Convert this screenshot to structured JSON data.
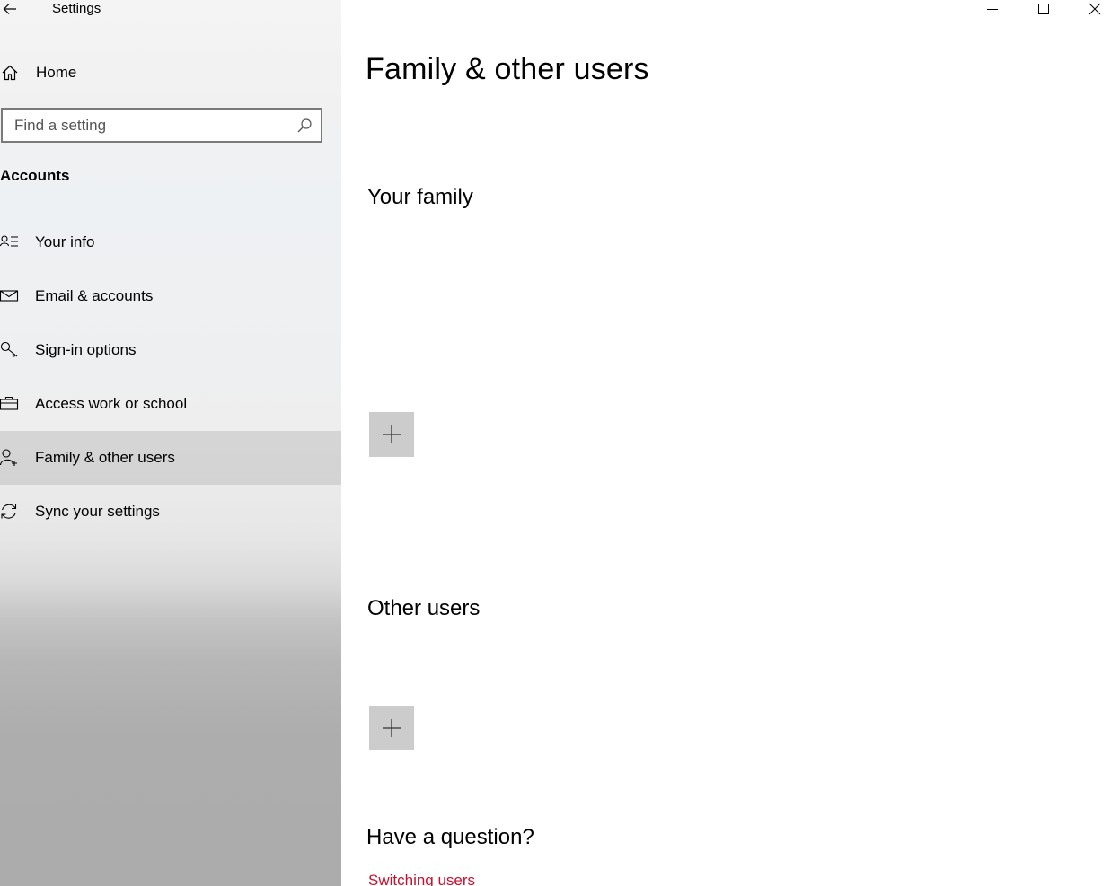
{
  "window": {
    "app_title": "Settings",
    "back_icon": "arrow-left-icon",
    "minimize_icon": "minimize-icon",
    "maximize_icon": "maximize-icon",
    "close_icon": "close-icon"
  },
  "sidebar": {
    "home_label": "Home",
    "home_icon": "home-icon",
    "search": {
      "placeholder": "Find a setting",
      "value": "",
      "icon": "search-icon"
    },
    "section_heading": "Accounts",
    "items": [
      {
        "label": "Your info",
        "icon": "contact-card-icon",
        "selected": false
      },
      {
        "label": "Email & accounts",
        "icon": "mail-icon",
        "selected": false
      },
      {
        "label": "Sign-in options",
        "icon": "key-icon",
        "selected": false
      },
      {
        "label": "Access work or school",
        "icon": "briefcase-icon",
        "selected": false
      },
      {
        "label": "Family & other users",
        "icon": "add-person-icon",
        "selected": true
      },
      {
        "label": "Sync your settings",
        "icon": "sync-icon",
        "selected": false
      }
    ],
    "selected_color": "#dadada"
  },
  "main": {
    "page_title": "Family & other users",
    "your_family_heading": "Your family",
    "other_users_heading": "Other users",
    "add_icon": "plus-icon",
    "question_heading": "Have a question?",
    "link_text": "Switching users",
    "link_color": "#c4122f",
    "tile_color": "#cccccc"
  }
}
